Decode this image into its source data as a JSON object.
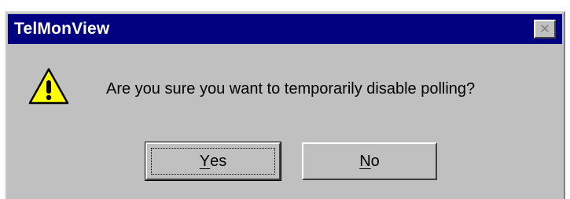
{
  "window": {
    "title": "TelMonView",
    "close_glyph": "✕"
  },
  "dialog": {
    "icon": "warning-icon",
    "message": "Are you sure you want to temporarily disable polling?"
  },
  "buttons": {
    "yes": {
      "mnemonic": "Y",
      "rest": "es"
    },
    "no": {
      "mnemonic": "N",
      "rest": "o"
    }
  },
  "colors": {
    "titlebar": "#000080",
    "face": "#c0c0c0",
    "warning_yellow": "#ffff00"
  }
}
